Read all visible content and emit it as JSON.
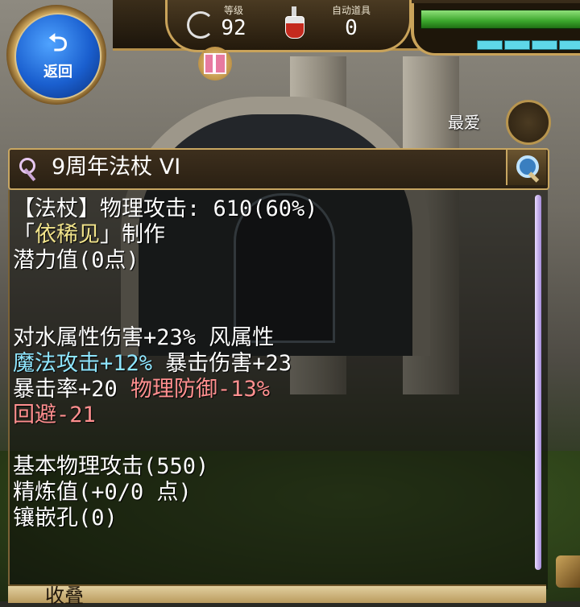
{
  "hud": {
    "back_label": "返回",
    "level_label": "等级",
    "level_value": "92",
    "auto_item_label": "自动道具",
    "auto_item_value": "0",
    "favorite_label": "最爱"
  },
  "item": {
    "name": "9周年法杖 VI"
  },
  "description": {
    "line1": "【法杖】物理攻击: 610(60%)",
    "line2_open": "「",
    "line2_maker": "依稀见",
    "line2_close": "」制作",
    "line3": "潜力值(0点)",
    "line4": "对水属性伤害+23% 风属性",
    "line5_cyan": "魔法攻击+12%",
    "line5_white": " 暴击伤害+23",
    "line6_white": "暴击率+20 ",
    "line6_red": "物理防御-13%",
    "line7_red": "回避-21",
    "line8": "基本物理攻击(550)",
    "line9": "精炼值(+0/0 点)",
    "line10": "镶嵌孔(0)"
  },
  "footer": {
    "label": "收叠"
  },
  "colors": {
    "maker_name": "#f1e38a",
    "magic_stat": "#8fe6ff",
    "negative_stat": "#ff8f8f"
  }
}
